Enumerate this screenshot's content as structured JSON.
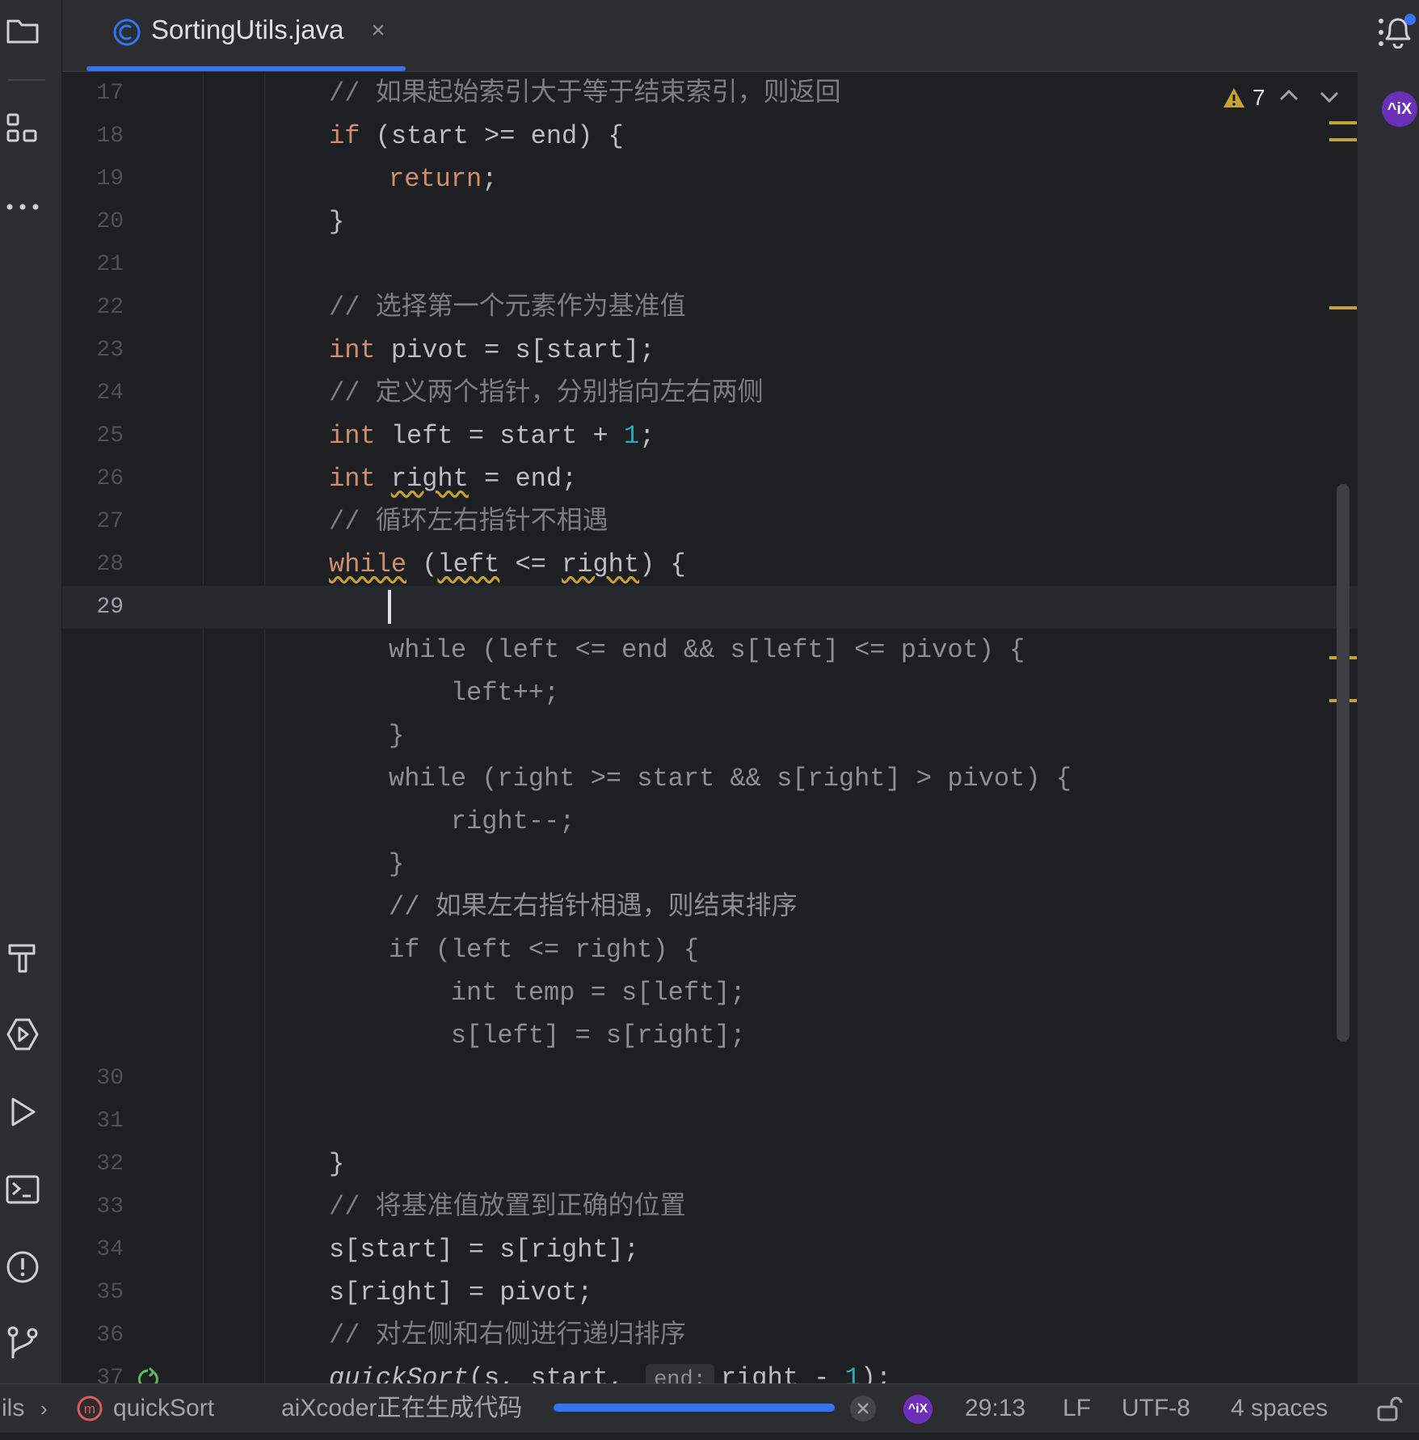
{
  "tab": {
    "filename": "SortingUtils.java",
    "close": "×"
  },
  "inspections": {
    "warning_count": "7"
  },
  "lines": [
    {
      "n": "17",
      "comment": "// 如果起始索引大于等于结束索引，则返回"
    },
    {
      "n": "18",
      "kw": "if",
      "text": " (start >= end) {"
    },
    {
      "n": "19",
      "kw": "return",
      "text": ";"
    },
    {
      "n": "20",
      "text": "}"
    },
    {
      "n": "21"
    },
    {
      "n": "22",
      "comment": "// 选择第一个元素作为基准值"
    },
    {
      "n": "23",
      "kw": "int",
      "text": " pivot = s[start];"
    },
    {
      "n": "24",
      "comment": "// 定义两个指针，分别指向左右两侧"
    },
    {
      "n": "25",
      "kw": "int",
      "text_a": " left = start + ",
      "num": "1",
      "text_b": ";"
    },
    {
      "n": "26",
      "kw": "int",
      "sq": "right",
      "text": " = end;"
    },
    {
      "n": "27",
      "comment": "// 循环左右指针不相遇"
    },
    {
      "n": "28",
      "sq1": "while",
      "p1": " (",
      "sq2": "left",
      "p2": " <= ",
      "sq3": "right",
      "p3": ") {"
    },
    {
      "n": "29"
    },
    {
      "n": "30"
    },
    {
      "n": "31"
    },
    {
      "n": "32",
      "text": "}"
    },
    {
      "n": "33",
      "comment": "// 将基准值放置到正确的位置"
    },
    {
      "n": "34",
      "text": "s[start] = s[right];"
    },
    {
      "n": "35",
      "text": "s[right] = pivot;"
    },
    {
      "n": "36",
      "comment": "// 对左侧和右侧进行递归排序"
    },
    {
      "n": "37",
      "fn": "quickSort",
      "text_a": "(s, start, ",
      "hint": "end:",
      "text_b": "right - ",
      "num": "1",
      "text_c": ");"
    }
  ],
  "ghost": [
    "while (left <= end && s[left] <= pivot) {",
    "    left++;",
    "}",
    "while (right >= start && s[right] > pivot) {",
    "    right--;",
    "}",
    "// 如果左右指针相遇，则结束排序",
    "if (left <= right) {",
    "    int temp = s[left];",
    "    s[left] = s[right];"
  ],
  "status": {
    "breadcrumb_file": "ils",
    "breadcrumb_method": "quickSort",
    "ai_message": "aiXcoder正在生成代码",
    "ai_progress": 1.0,
    "position": "29:13",
    "line_sep": "LF",
    "encoding": "UTF-8",
    "indent": "4 spaces"
  },
  "colors": {
    "accent": "#3574f0",
    "keyword": "#cf8e6d",
    "number": "#2aacb8",
    "warning": "#c7a232",
    "ai_badge": "#6b2fba"
  },
  "icons": [
    "folder-icon",
    "structure-icon",
    "more-icon",
    "build-icon",
    "services-icon",
    "run-icon",
    "terminal-icon",
    "problems-icon",
    "git-icon",
    "notifications-icon",
    "aixcoder-icon"
  ]
}
